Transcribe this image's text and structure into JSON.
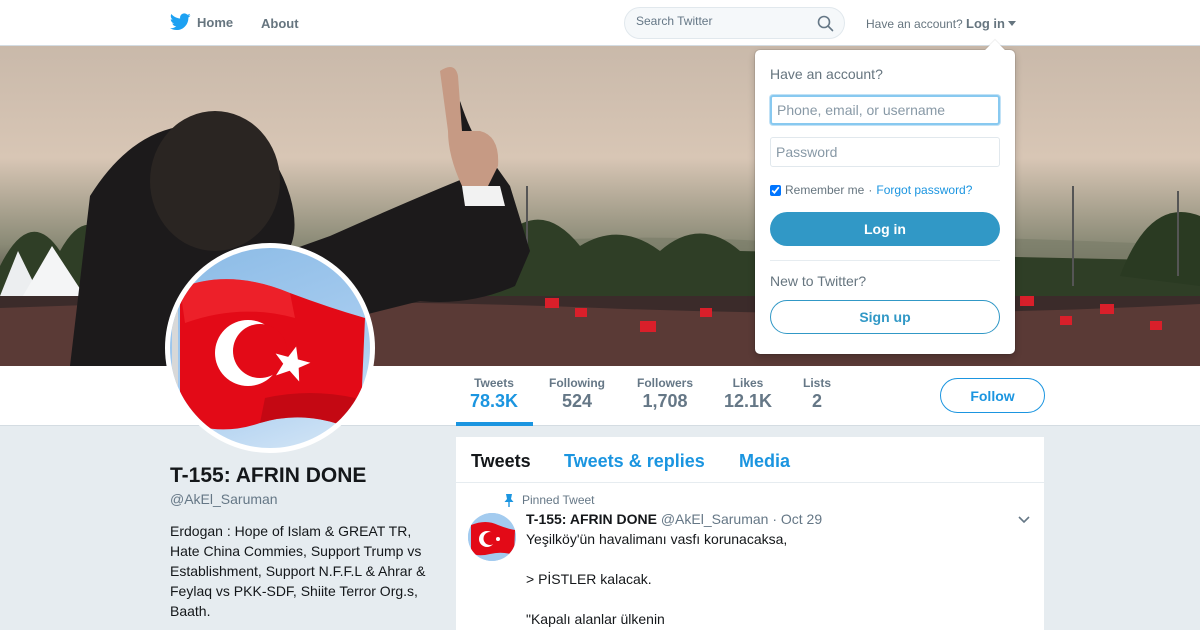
{
  "nav": {
    "home_label": "Home",
    "about_label": "About",
    "search_placeholder": "Search Twitter",
    "have_account": "Have an account?",
    "login_label": "Log in",
    "brand_color": "#1da1f2"
  },
  "profile": {
    "name": "T-155: AFRIN DONE",
    "handle": "@AkEl_Saruman",
    "bio": "Erdogan : Hope of Islam & GREAT TR, Hate China Commies, Support Trump vs Establishment, Support N.F.F.L & Ahrar & Feylaq vs PKK-SDF, Shiite Terror Org.s, Baath."
  },
  "stats": [
    {
      "label": "Tweets",
      "value": "78.3K",
      "active": true
    },
    {
      "label": "Following",
      "value": "524"
    },
    {
      "label": "Followers",
      "value": "1,708"
    },
    {
      "label": "Likes",
      "value": "12.1K"
    },
    {
      "label": "Lists",
      "value": "2"
    }
  ],
  "follow_label": "Follow",
  "timeline": {
    "tabs": [
      "Tweets",
      "Tweets & replies",
      "Media"
    ],
    "active_tab": "Tweets",
    "pinned_label": "Pinned Tweet",
    "tweet": {
      "name": "T-155: AFRIN DONE",
      "handle": "@AkEl_Saruman",
      "separator": "·",
      "time": "Oct 29",
      "lines": [
        "Yeşilköy'ün havalimanı vasfı korunacaksa,",
        "> PİSTLER kalacak.",
        "\"Kapalı alanlar ülkenin"
      ]
    }
  },
  "login_dropdown": {
    "title": "Have an account?",
    "username_placeholder": "Phone, email, or username",
    "password_placeholder": "Password",
    "remember_label": "Remember me",
    "separator": "·",
    "forgot_label": "Forgot password?",
    "login_button": "Log in",
    "new_label": "New to Twitter?",
    "signup_button": "Sign up",
    "remember_checked": true
  },
  "colors": {
    "accent": "#1b95e0",
    "login_button": "#3198c6",
    "page_bg": "#e6ecf0",
    "flag_red": "#e30a17"
  }
}
